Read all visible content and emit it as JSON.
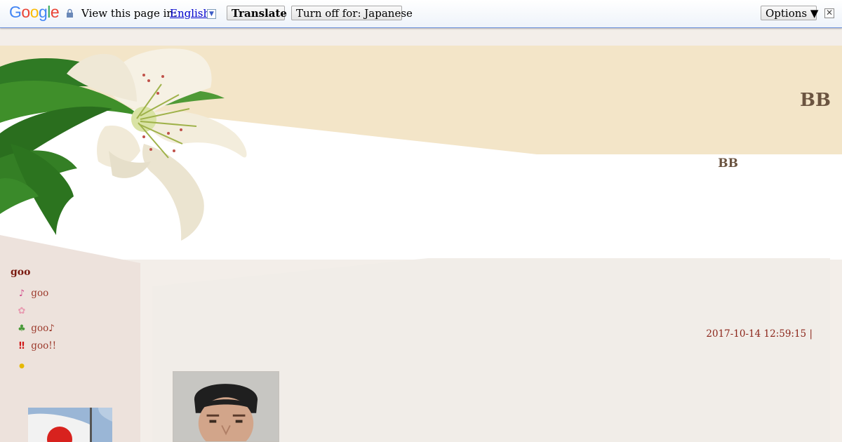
{
  "translate_bar": {
    "logo": [
      "G",
      "o",
      "o",
      "g",
      "l",
      "e"
    ],
    "view_label": "View this page in:",
    "language": "English",
    "translate_button": "Translate",
    "turn_off_button": "Turn off for: Japanese",
    "options_button": "Options ▼",
    "close_symbol": "✕"
  },
  "header": {
    "title": "BB",
    "subtitle": "BB"
  },
  "sidebar": {
    "heading": "goo",
    "items": [
      {
        "icon": "♪",
        "label": "goo",
        "icon_color": "#d04a8a"
      },
      {
        "icon": "✿",
        "label": "",
        "icon_color": "#e89ab0"
      },
      {
        "icon": "♣",
        "label": "goo♪",
        "icon_color": "#4a9a3a"
      },
      {
        "icon": "‼",
        "label": "goo!!",
        "icon_color": "#d01818"
      },
      {
        "icon": "●",
        "label": "",
        "icon_color": "#e6b800"
      }
    ]
  },
  "post": {
    "date": "2017-10-14 12:59:15 |"
  },
  "colors": {
    "header_band": "#f3e5c8",
    "sidebar": "#ede2dc",
    "content": "#f1ede8",
    "title_text": "#6b5440",
    "link": "#9c3a2c"
  }
}
